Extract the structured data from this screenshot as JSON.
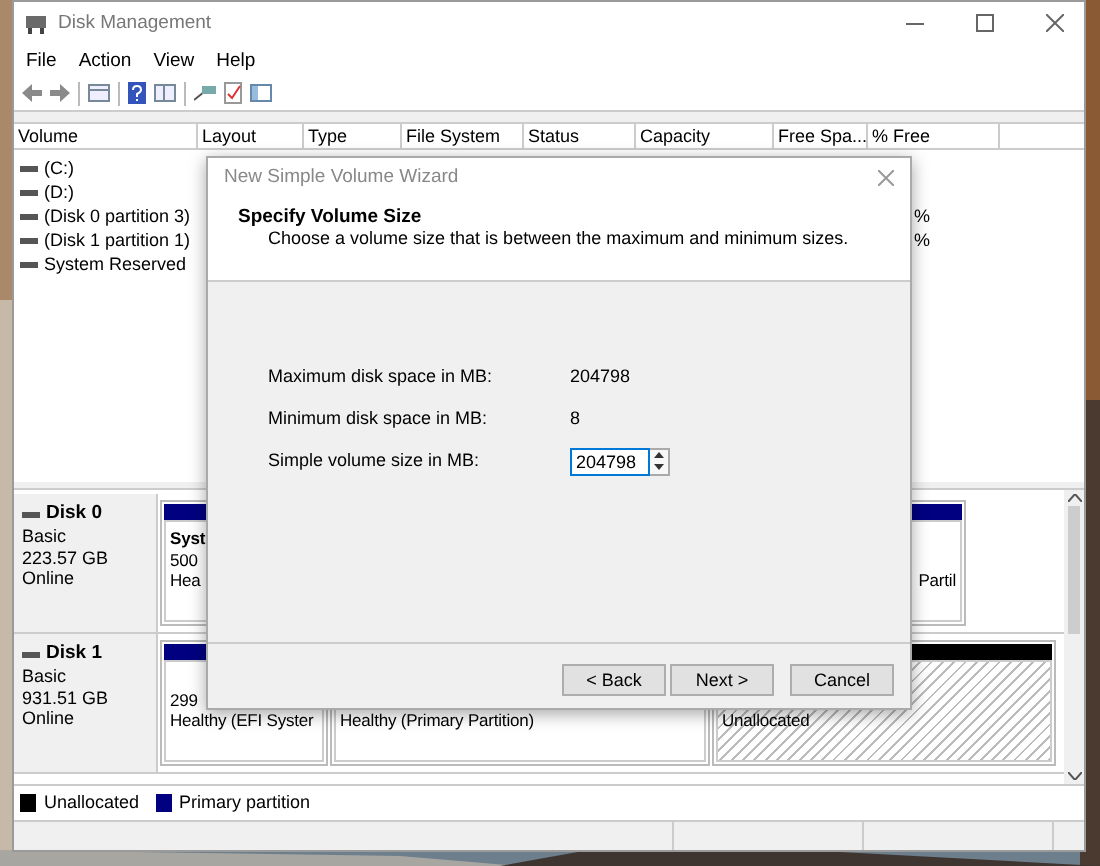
{
  "window": {
    "title": "Disk Management"
  },
  "menu": [
    "File",
    "Action",
    "View",
    "Help"
  ],
  "volume_table": {
    "columns": [
      "Volume",
      "Layout",
      "Type",
      "File System",
      "Status",
      "Capacity",
      "Free Spa...",
      "% Free"
    ],
    "rows": [
      {
        "volume": "(C:)"
      },
      {
        "volume": "(D:)"
      },
      {
        "volume": "(Disk 0 partition 3)",
        "pct_free": "%"
      },
      {
        "volume": "(Disk 1 partition 1)",
        "pct_free": "%"
      },
      {
        "volume": "System Reserved"
      }
    ]
  },
  "disks": [
    {
      "name": "Disk 0",
      "type": "Basic",
      "size": "223.57 GB",
      "status": "Online",
      "partitions": [
        {
          "kind": "primary",
          "label": "Syst",
          "size": "500",
          "status": "Hea"
        },
        {
          "kind": "primary",
          "status": "Partil"
        }
      ]
    },
    {
      "name": "Disk 1",
      "type": "Basic",
      "size": "931.51 GB",
      "status": "Online",
      "partitions": [
        {
          "kind": "primary",
          "size": "299",
          "status": "Healthy (EFI Syster"
        },
        {
          "kind": "primary",
          "status": "Healthy (Primary Partition)"
        },
        {
          "kind": "unallocated",
          "status": "Unallocated"
        }
      ]
    }
  ],
  "legend": [
    {
      "label": "Unallocated",
      "color": "#000000"
    },
    {
      "label": "Primary partition",
      "color": "#000080"
    }
  ],
  "dialog": {
    "title": "New Simple Volume Wizard",
    "heading": "Specify Volume Size",
    "description": "Choose a volume size that is between the maximum and minimum sizes.",
    "fields": [
      {
        "kind": "readout",
        "label": "Maximum disk space in MB:",
        "value": "204798"
      },
      {
        "kind": "readout",
        "label": "Minimum disk space in MB:",
        "value": "8"
      },
      {
        "kind": "spinner",
        "label": "Simple volume size in MB:",
        "value": "204798"
      }
    ],
    "buttons": [
      "< Back",
      "Next >",
      "Cancel"
    ]
  }
}
